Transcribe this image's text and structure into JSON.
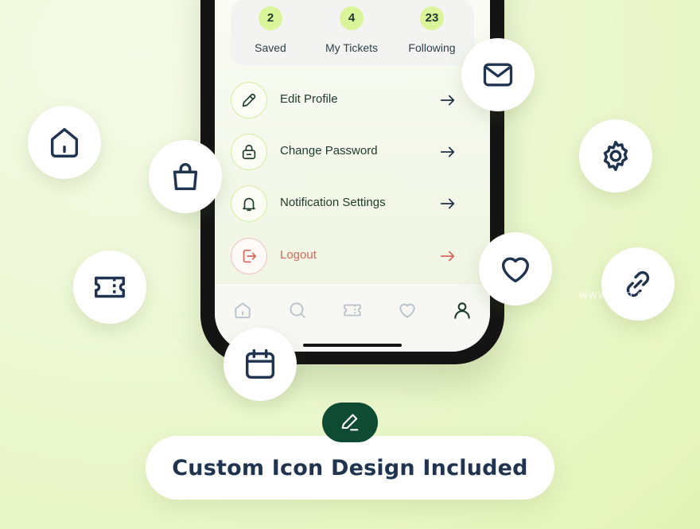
{
  "stats": [
    {
      "value": "2",
      "label": "Saved"
    },
    {
      "value": "4",
      "label": "My Tickets"
    },
    {
      "value": "23",
      "label": "Following"
    }
  ],
  "menu": [
    {
      "label": "Edit Profile",
      "icon": "pencil-icon"
    },
    {
      "label": "Change Password",
      "icon": "lock-icon"
    },
    {
      "label": "Notification Settings",
      "icon": "bell-icon"
    },
    {
      "label": "Logout",
      "icon": "logout-icon"
    }
  ],
  "tabbar": [
    "home-icon",
    "search-icon",
    "ticket-icon",
    "heart-icon",
    "user-icon"
  ],
  "floating_icons": [
    "mail-icon",
    "home-icon",
    "shopping-bag-icon",
    "gear-icon",
    "ticket-icon",
    "heart-icon",
    "link-icon",
    "calendar-icon"
  ],
  "caption": "Custom Icon Design Included",
  "watermark": "www.ooo.com",
  "colors": {
    "accent_green": "#daf49a",
    "dark_green": "#0f4a33",
    "navy": "#203450",
    "logout_red": "#d8675a"
  }
}
